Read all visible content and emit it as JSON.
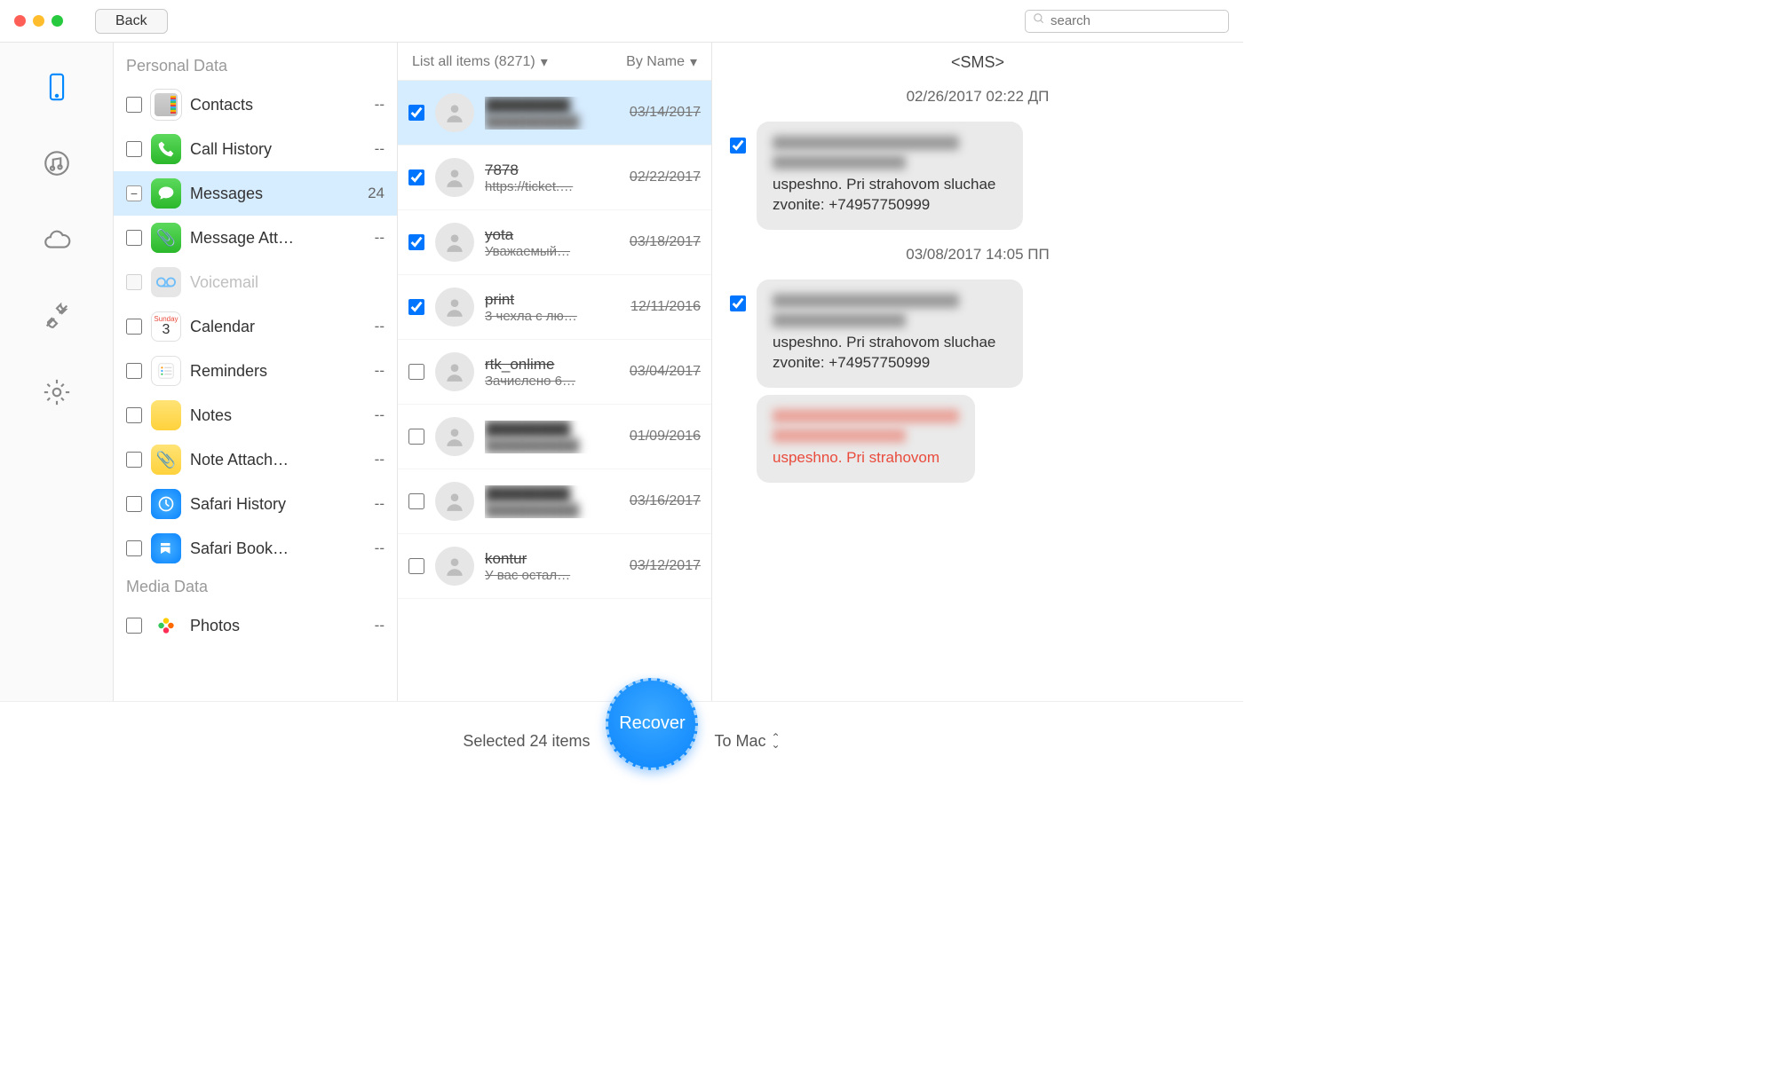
{
  "titlebar": {
    "back": "Back",
    "search_placeholder": "search"
  },
  "sections": {
    "personal_header": "Personal Data",
    "media_header": "Media Data"
  },
  "categories": [
    {
      "label": "Contacts",
      "count": "--"
    },
    {
      "label": "Call History",
      "count": "--"
    },
    {
      "label": "Messages",
      "count": "24",
      "active": true
    },
    {
      "label": "Message Att…",
      "count": "--"
    },
    {
      "label": "Voicemail",
      "count": "",
      "disabled": true
    },
    {
      "label": "Calendar",
      "count": "--"
    },
    {
      "label": "Reminders",
      "count": "--"
    },
    {
      "label": "Notes",
      "count": "--"
    },
    {
      "label": "Note Attach…",
      "count": "--"
    },
    {
      "label": "Safari History",
      "count": "--"
    },
    {
      "label": "Safari Book…",
      "count": "--"
    },
    {
      "label": "Photos",
      "count": "--"
    }
  ],
  "mid": {
    "filter": "List all items (8271)",
    "sort": "By Name",
    "items": [
      {
        "name": "",
        "preview": "",
        "date": "03/14/2017",
        "checked": true,
        "blurred": true
      },
      {
        "name": "7878",
        "preview": "https://ticket.…",
        "date": "02/22/2017",
        "checked": true
      },
      {
        "name": "yota",
        "preview": "Уважаемый…",
        "date": "03/18/2017",
        "checked": true
      },
      {
        "name": "print",
        "preview": "3 чехла с лю…",
        "date": "12/11/2016",
        "checked": true
      },
      {
        "name": "rtk_onlime",
        "preview": "Зачислено 6…",
        "date": "03/04/2017",
        "checked": false
      },
      {
        "name": "",
        "preview": "",
        "date": "01/09/2016",
        "checked": false,
        "blurred": true
      },
      {
        "name": "",
        "preview": "",
        "date": "03/16/2017",
        "checked": false,
        "blurred": true
      },
      {
        "name": "kontur",
        "preview": "У вас остал…",
        "date": "03/12/2017",
        "checked": false
      }
    ]
  },
  "detail": {
    "title": "<SMS>",
    "ts1": "02/26/2017 02:22 ДП",
    "ts2": "03/08/2017 14:05 ПП",
    "bubble_text": "uspeshno. Pri strahovom sluchae zvonite: +74957750999",
    "bubble_text3": "uspeshno. Pri strahovom"
  },
  "footer": {
    "selected": "Selected 24 items",
    "recover": "Recover",
    "target": "To Mac"
  }
}
